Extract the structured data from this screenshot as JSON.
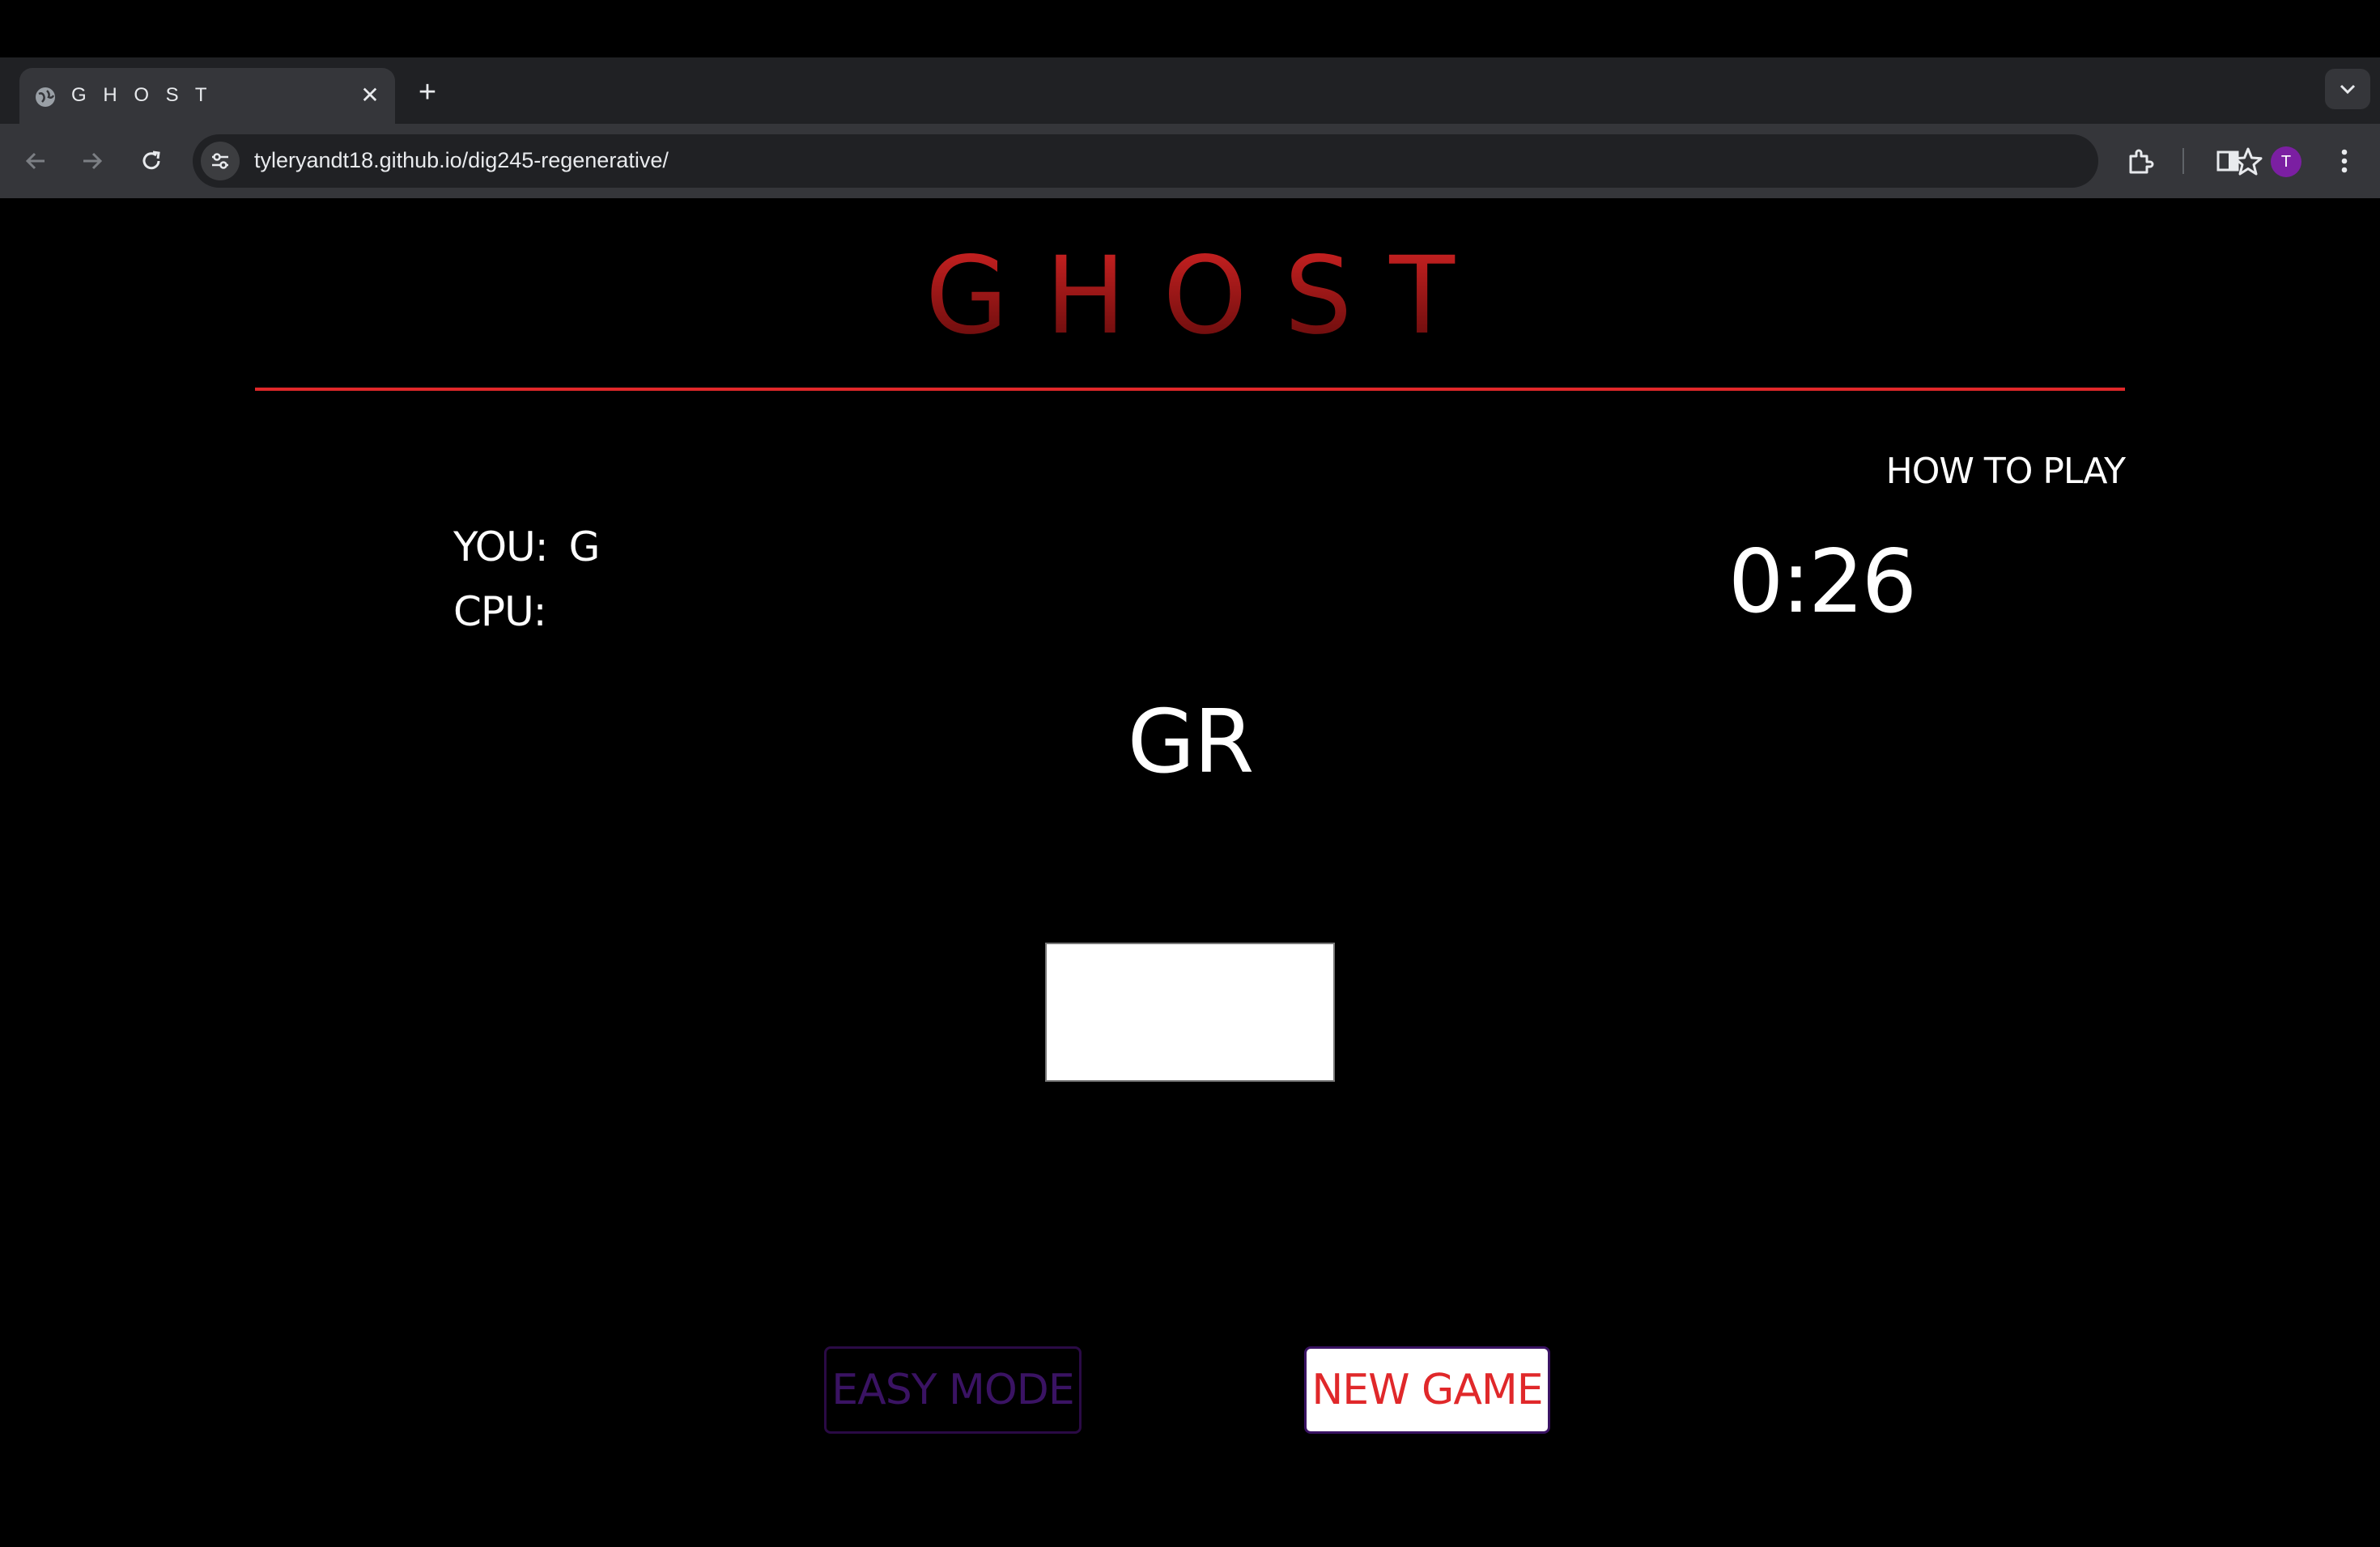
{
  "browser": {
    "tab_title": "G H O S T",
    "tab_close_glyph": "✕",
    "new_tab_glyph": "+",
    "url_host": "tyleryandt18.github.io",
    "url_path": "/dig245-regenerative/",
    "avatar_letter": "T"
  },
  "game": {
    "title": "GHOST",
    "how_to_play": "HOW TO PLAY",
    "you_label": "YOU:",
    "you_letters": "G",
    "cpu_label": "CPU:",
    "cpu_letters": "",
    "timer": "0:26",
    "current_word": "GR",
    "input_value": "",
    "easy_mode_label": "EASY MODE",
    "new_game_label": "NEW GAME"
  },
  "colors": {
    "accent_red": "#e0282a",
    "easy_purple": "#3a1363",
    "background": "#000000"
  }
}
